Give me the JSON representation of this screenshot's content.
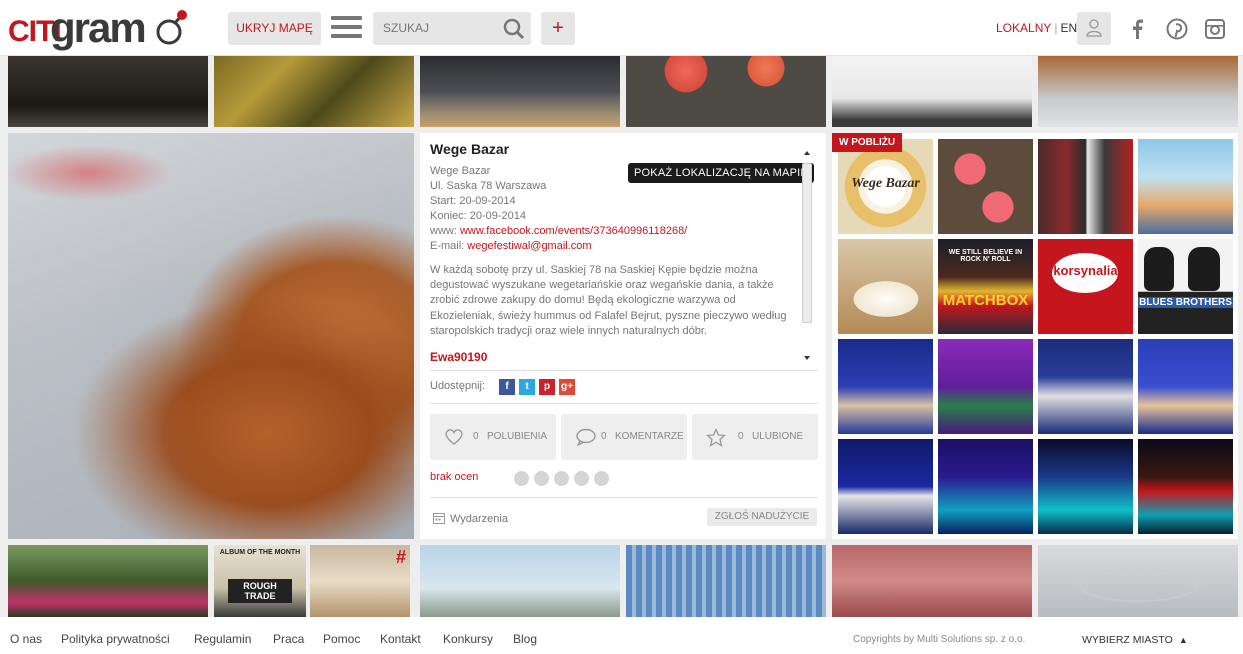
{
  "header": {
    "logo_citi": "CITI",
    "logo_gram": "gram",
    "hide_map_label": "UKRYJ MAPĘ",
    "search_placeholder": "SZUKAJ",
    "add_label": "+",
    "lang_active": "LOKALNY",
    "lang_sep": "|",
    "lang_other": "EN"
  },
  "event": {
    "title": "Wege Bazar",
    "map_button": "POKAŻ LOKALIZACJĘ NA MAPIE",
    "place": "Wege Bazar",
    "address": "Ul. Saska 78 Warszawa",
    "start": "Start: 20-09-2014",
    "end": "Koniec: 20-09-2014",
    "www_label": "www:",
    "www": "www.facebook.com/events/373640996118268/",
    "email_label": "E-mail:",
    "email": "wegefestiwal@gmail.com",
    "description": "W każdą sobotę przy ul. Saskiej 78 na Saskiej Kępie będzie można degustować wyszukane wegetariańskie oraz wegańskie dania, a także zrobić zdrowe zakupy do domu! Będą ekologiczne warzywa od Ekozieleniak, świeży hummus od Falafel Bejrut, pyszne pieczywo według staropolskich tradycji oraz wiele innych naturalnych dóbr.",
    "author": "Ewa90190",
    "share_label": "Udostępnij:",
    "likes_count": "0",
    "likes_label": "POLUBIENIA",
    "comments_count": "0",
    "comments_label": "KOMENTARZE",
    "favorites_count": "0",
    "favorites_label": "ULUBIONE",
    "rating_label": "brak ocen",
    "category": "Wydarzenia",
    "report_label": "ZGŁOŚ NADUŻYCIE"
  },
  "nearby": {
    "badge": "W POBLIŻU",
    "tile_texts": {
      "wege": "Wege Bazar",
      "rock": "WE STILL BELIEVE IN ROCK N' ROLL",
      "matchbox": "MATCHBOX",
      "korsynalia": "korsynalia",
      "blues": "BLUES BROTHERS"
    }
  },
  "bottom_tiles": {
    "hash": "#",
    "album_text": "ALBUM OF THE MONTH",
    "rough_trade": "ROUGH TRADE"
  },
  "footer": {
    "links": [
      "O nas",
      "Polityka prywatności",
      "Regulamin",
      "Praca",
      "Pomoc",
      "Kontakt",
      "Konkursy",
      "Blog"
    ],
    "copyright": "Copyrights by Multi Solutions sp. z o.o.",
    "city": "WYBIERZ MIASTO",
    "city_arrow": "▲"
  },
  "colors": {
    "accent": "#c4161c",
    "panel": "#ffffff",
    "background": "#eeeeee"
  }
}
